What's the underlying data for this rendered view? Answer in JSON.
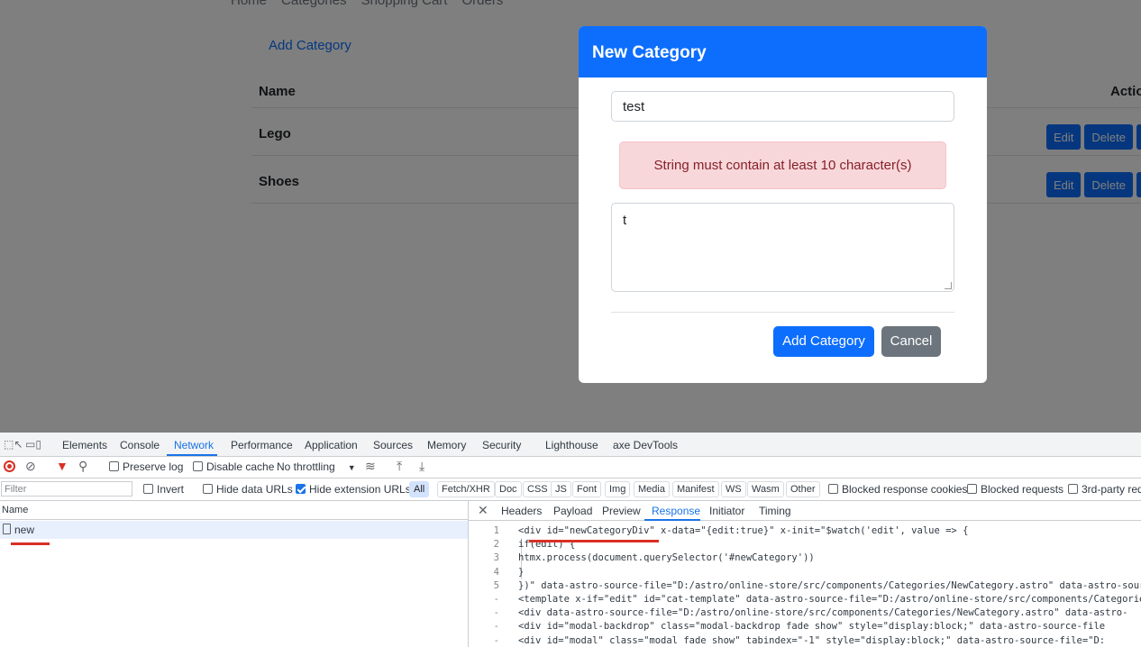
{
  "app": {
    "nav": [
      "Home",
      "Categories",
      "Shopping Cart",
      "Orders"
    ],
    "add_category_link": "Add Category",
    "table": {
      "headers": {
        "name": "Name",
        "actions": "Actio"
      },
      "rows": [
        {
          "name": "Lego",
          "edit": "Edit",
          "delete": "Delete"
        },
        {
          "name": "Shoes",
          "edit": "Edit",
          "delete": "Delete"
        }
      ]
    }
  },
  "modal": {
    "title": "New Category",
    "name_value": "test",
    "error": "String must contain at least 10 character(s)",
    "description_value": "t",
    "add_button": "Add Category",
    "cancel_button": "Cancel"
  },
  "devtools": {
    "tabs": [
      "Elements",
      "Console",
      "Network",
      "Performance",
      "Application",
      "Sources",
      "Memory",
      "Security",
      "Lighthouse",
      "axe DevTools"
    ],
    "active_tab": "Network",
    "toolbar": {
      "preserve_log": "Preserve log",
      "disable_cache": "Disable cache",
      "throttling": "No throttling"
    },
    "filterbar": {
      "filter_placeholder": "Filter",
      "invert": "Invert",
      "hide_data_urls": "Hide data URLs",
      "hide_extension_urls": "Hide extension URLs",
      "types": [
        "All",
        "Fetch/XHR",
        "Doc",
        "CSS",
        "JS",
        "Font",
        "Img",
        "Media",
        "Manifest",
        "WS",
        "Wasm",
        "Other"
      ],
      "blocked_cookies": "Blocked response cookies",
      "blocked_requests": "Blocked requests",
      "third_party": "3rd-party req"
    },
    "requests": {
      "column": "Name",
      "items": [
        "new"
      ]
    },
    "detail_tabs": [
      "Headers",
      "Payload",
      "Preview",
      "Response",
      "Initiator",
      "Timing"
    ],
    "active_detail_tab": "Response",
    "response_lines": [
      {
        "num": "1",
        "text": "<div id=\"newCategoryDiv\" x-data=\"{edit:true}\" x-init=\"$watch('edit', value => {"
      },
      {
        "num": "2",
        "text": "    if(edit) {"
      },
      {
        "num": "3",
        "text": "      htmx.process(document.querySelector('#newCategory'))"
      },
      {
        "num": "4",
        "text": "    }"
      },
      {
        "num": "5",
        "text": "  })\" data-astro-source-file=\"D:/astro/online-store/src/components/Categories/NewCategory.astro\" data-astro-source-"
      },
      {
        "num": "-",
        "text": "    <template x-if=\"edit\" id=\"cat-template\" data-astro-source-file=\"D:/astro/online-store/src/components/Categories"
      },
      {
        "num": "-",
        "text": "      <div data-astro-source-file=\"D:/astro/online-store/src/components/Categories/NewCategory.astro\" data-astro-"
      },
      {
        "num": "-",
        "text": "        <div id=\"modal-backdrop\" class=\"modal-backdrop fade show\" style=\"display:block;\" data-astro-source-file"
      },
      {
        "num": "-",
        "text": "        <div id=\"modal\" class=\"modal fade show\" tabindex=\"-1\" style=\"display:block;\" data-astro-source-file=\"D:"
      }
    ]
  }
}
